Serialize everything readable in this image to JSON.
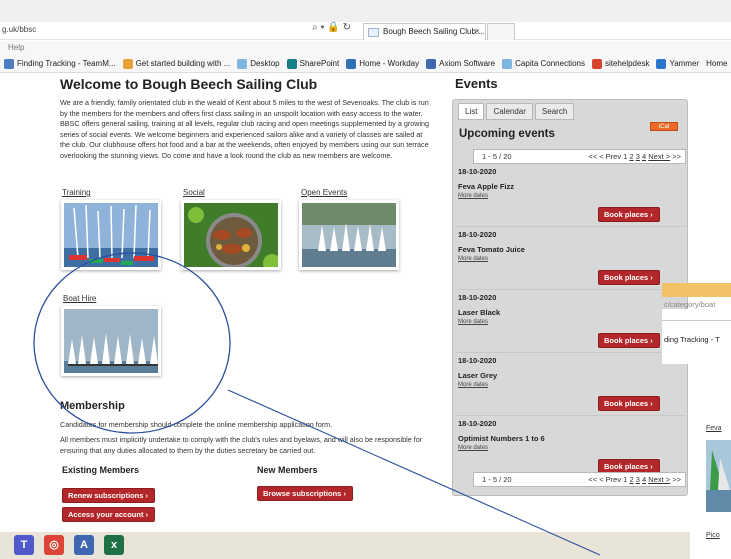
{
  "browser": {
    "url": "g.uk/bbsc",
    "menu_label": "Help",
    "tab_title": "Bough Beech Sailing Club:...",
    "tab_close": "×",
    "address_icons": "⌕ ▾ 🔒 ↻",
    "favorites": [
      {
        "label": "Finding Tracking - TeamM...",
        "icon": "tracking-icon",
        "color": "#4d7cc3"
      },
      {
        "label": "Get started building with ...",
        "icon": "windows-colored-icon",
        "color": "#e8a23a"
      },
      {
        "label": "Desktop",
        "icon": "ie-page-icon",
        "color": "#7fb3e0"
      },
      {
        "label": "SharePoint",
        "icon": "sharepoint-icon",
        "color": "#138086"
      },
      {
        "label": "Home - Workday",
        "icon": "workday-icon",
        "color": "#2f6fb5"
      },
      {
        "label": "Axiom Software",
        "icon": "axiom-icon",
        "color": "#3f66b0"
      },
      {
        "label": "Capita Connections",
        "icon": "ie-page-icon",
        "color": "#7fb3e0"
      },
      {
        "label": "sitehelpdesk",
        "icon": "helpdesk-icon",
        "color": "#d8442e"
      },
      {
        "label": "Yammer",
        "icon": "yammer-icon",
        "color": "#2a75c9"
      },
      {
        "label": "Home",
        "icon": "",
        "color": ""
      }
    ]
  },
  "page": {
    "title": "Welcome to Bough Beech Sailing Club",
    "intro_lines": [
      "We are a friendly, family orientated club in the weald of Kent about 5 miles to the west of Sevenoaks. The club is run",
      "by the members for the members and offers first class sailing in an unspoilt location with easy access to the water.",
      "BBSC offers general sailing, training at all levels, regular club racing and open meetings supplemented by a growing",
      "series of social events. We welcome beginners and experienced sailors alike and a variety of classes are sailed at",
      "the club. Our clubhouse offers hot food and a bar at the weekends, often enjoyed by members using our sun terrace",
      "overlooking the stunning views. Do come and have a look round the club as new members are welcome."
    ],
    "categories": {
      "training": "Training",
      "social": "Social",
      "open_events": "Open Events",
      "boat_hire": "Boat Hire"
    },
    "membership": {
      "title": "Membership",
      "line1": "Candidates for membership should complete the online membership application form.",
      "line2": "All members must implicitly undertake to comply with the club's rules and byelaws, and will also be responsible for",
      "line3": "ensuring that any duties allocated to them by the duties secretary be carried out.",
      "existing_title": "Existing Members",
      "new_title": "New Members",
      "renew_btn": "Renew subscriptions",
      "access_btn": "Access your account",
      "browse_btn": "Browse subscriptions",
      "chevron": "›"
    }
  },
  "events": {
    "title": "Events",
    "tabs": [
      "List",
      "Calendar",
      "Search"
    ],
    "upcoming_title": "Upcoming events",
    "ical_label": "iCal",
    "pager": {
      "range": "1 - 5 / 20",
      "nav_prefix": "<< < Prev 1 ",
      "pages": [
        "2",
        "3",
        "4"
      ],
      "next": "Next >",
      "last": ">>"
    },
    "items": [
      {
        "date": "18-10-2020",
        "name": "Feva Apple Fizz",
        "more": "More dates",
        "book": "Book places"
      },
      {
        "date": "18-10-2020",
        "name": "Feva Tomato Juice",
        "more": "More dates",
        "book": "Book places"
      },
      {
        "date": "18-10-2020",
        "name": "Laser Black",
        "more": "More dates",
        "book": "Book places"
      },
      {
        "date": "18-10-2020",
        "name": "Laser Grey",
        "more": "More dates",
        "book": "Book places"
      },
      {
        "date": "18-10-2020",
        "name": "Optimist Numbers 1 to 6",
        "more": "More dates",
        "book": "Book places"
      }
    ]
  },
  "overlay": {
    "url_fragment": "c/category/boat",
    "fav_fragment": "ding Tracking - T",
    "feva": "Feva",
    "pico": "Pico"
  },
  "taskbar": {
    "icons": [
      {
        "name": "teams-icon",
        "label": "T",
        "color": "#5059c9"
      },
      {
        "name": "chrome-icon",
        "label": "◎",
        "color": "#db4437"
      },
      {
        "name": "axiom-app-icon",
        "label": "A",
        "color": "#3f66b0"
      },
      {
        "name": "excel-icon",
        "label": "x",
        "color": "#1e7145"
      }
    ]
  },
  "annotation_color": "#2c4f9e"
}
